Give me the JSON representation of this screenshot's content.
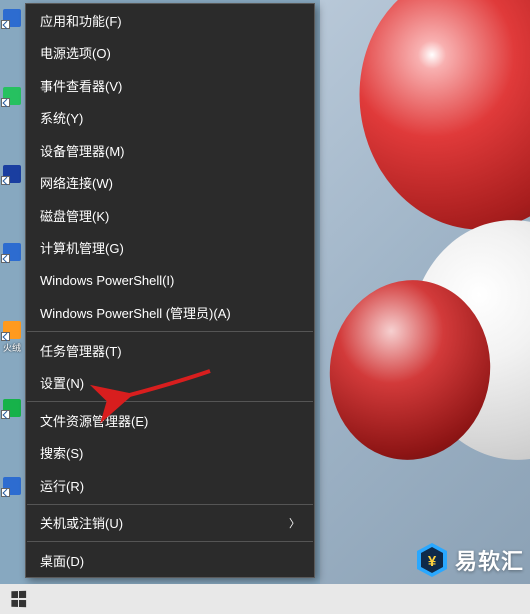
{
  "menu": {
    "groups": [
      [
        {
          "label": "应用和功能(F)",
          "name": "menu-apps-features"
        },
        {
          "label": "电源选项(O)",
          "name": "menu-power-options"
        },
        {
          "label": "事件查看器(V)",
          "name": "menu-event-viewer"
        },
        {
          "label": "系统(Y)",
          "name": "menu-system"
        },
        {
          "label": "设备管理器(M)",
          "name": "menu-device-manager"
        },
        {
          "label": "网络连接(W)",
          "name": "menu-network-connections"
        },
        {
          "label": "磁盘管理(K)",
          "name": "menu-disk-management"
        },
        {
          "label": "计算机管理(G)",
          "name": "menu-computer-management"
        },
        {
          "label": "Windows PowerShell(I)",
          "name": "menu-powershell"
        },
        {
          "label": "Windows PowerShell (管理员)(A)",
          "name": "menu-powershell-admin"
        }
      ],
      [
        {
          "label": "任务管理器(T)",
          "name": "menu-task-manager"
        },
        {
          "label": "设置(N)",
          "name": "menu-settings"
        }
      ],
      [
        {
          "label": "文件资源管理器(E)",
          "name": "menu-file-explorer"
        },
        {
          "label": "搜索(S)",
          "name": "menu-search"
        },
        {
          "label": "运行(R)",
          "name": "menu-run"
        }
      ],
      [
        {
          "label": "关机或注销(U)",
          "name": "menu-shutdown-signout",
          "submenu": true
        }
      ],
      [
        {
          "label": "桌面(D)",
          "name": "menu-desktop"
        }
      ]
    ]
  },
  "desktop": {
    "label_shortcut": "火绒"
  },
  "watermark": {
    "text": "易软汇"
  }
}
